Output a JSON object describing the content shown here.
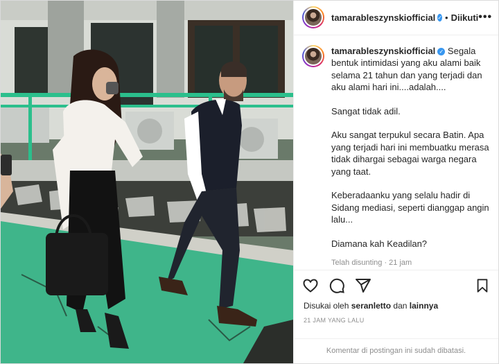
{
  "post": {
    "username": "tamarableszynskiofficial",
    "follow_label": "Diikuti",
    "more_label": "•••",
    "verified_mark": "✓",
    "caption_paragraphs": [
      "Segala bentuk intimidasi yang aku alami baik selama 21 tahun dan yang terjadi dan aku alami hari ini....adalah....",
      "Sangat tidak adil.",
      "Aku sangat terpukul secara Batin. Apa yang terjadi hari ini membuatku merasa tidak dihargai sebagai warga negara yang taat.",
      "Keberadaanku yang selalu hadir di Sidang mediasi, seperti dianggap angin lalu...",
      "Diamana kah Keadilan?"
    ],
    "edited_label": "Telah disunting",
    "edited_time": "21 jam",
    "likes_prefix": "Disukai oleh",
    "likes_user": "seranletto",
    "likes_and": "dan",
    "likes_others": "lainnya",
    "timestamp": "21 JAM YANG LALU",
    "comments_disabled": "Komentar di postingan ini sudah dibatasi."
  },
  "icons": [
    "heart-icon",
    "comment-icon",
    "share-icon",
    "bookmark-icon"
  ],
  "colors": {
    "verified": "#3897f0",
    "text": "#262626",
    "muted": "#8e8e8e",
    "border": "#efefef"
  }
}
